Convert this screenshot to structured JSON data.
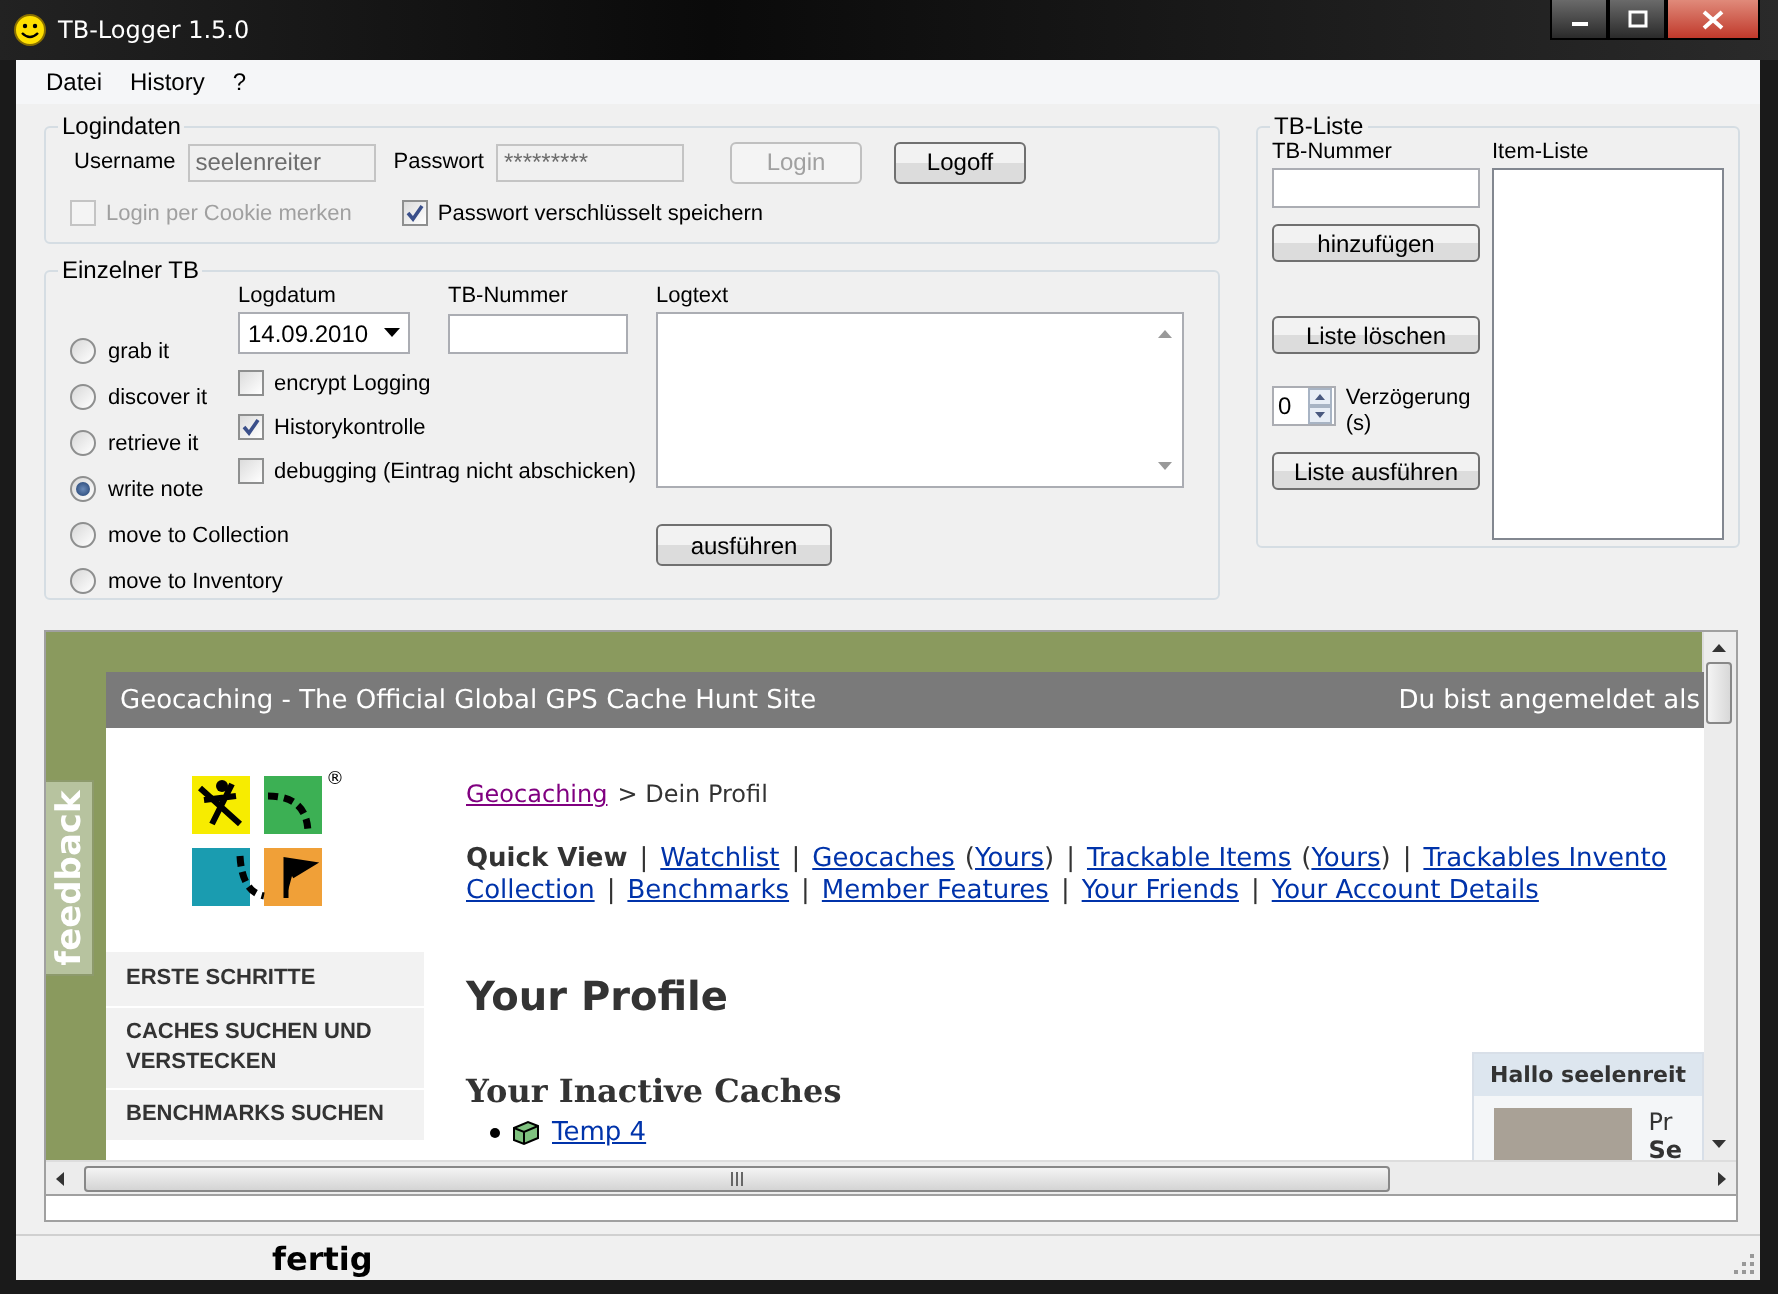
{
  "window": {
    "title": "TB-Logger 1.5.0"
  },
  "menu": [
    {
      "label": "Datei"
    },
    {
      "label": "History"
    },
    {
      "label": "?"
    }
  ],
  "login": {
    "title": "Logindaten",
    "username_label": "Username",
    "username": "seelenreiter",
    "password_label": "Passwort",
    "password": "*********",
    "buttons": [
      {
        "label": "Login",
        "disabled": true
      },
      {
        "label": "Logoff",
        "disabled": false
      }
    ],
    "options": [
      {
        "label": "Login per Cookie merken",
        "checked": false,
        "disabled": true
      },
      {
        "label": "Passwort verschlüsselt speichern",
        "checked": true,
        "disabled": false
      }
    ]
  },
  "single": {
    "title": "Einzelner TB",
    "actions": [
      {
        "label": "grab it",
        "selected": false
      },
      {
        "label": "discover it",
        "selected": false
      },
      {
        "label": "retrieve it",
        "selected": false
      },
      {
        "label": "write note",
        "selected": true
      },
      {
        "label": "move to Collection",
        "selected": false
      },
      {
        "label": "move to Inventory",
        "selected": false
      }
    ],
    "date_label": "Logdatum",
    "date": "14.09.2010",
    "number_label": "TB-Nummer",
    "options": [
      {
        "label": "encrypt Logging",
        "checked": false
      },
      {
        "label": "Historykontrolle",
        "checked": true
      },
      {
        "label": "debugging (Eintrag nicht abschicken)",
        "checked": false
      }
    ],
    "logtext_label": "Logtext",
    "run_button": "ausführen"
  },
  "list": {
    "title": "TB-Liste",
    "number_label": "TB-Nummer",
    "add_button": "hinzufügen",
    "clear_button": "Liste löschen",
    "delay": "0",
    "delay_label": "Verzögerung (s)",
    "run_button": "Liste ausführen",
    "items_label": "Item-Liste"
  },
  "browser": {
    "header_title": "Geocaching - The Official Global GPS Cache Hunt Site",
    "header_user": "Du bist angemeldet als",
    "feedback": "feedback",
    "logo_mark": "®",
    "nav": [
      "ERSTE SCHRITTE",
      "CACHES SUCHEN UND VERSTECKEN",
      "BENCHMARKS SUCHEN"
    ],
    "breadcrumb": {
      "link": "Geocaching",
      "rest": "> Dein Profil"
    },
    "quick_view": [
      [
        {
          "kind": "label",
          "text": "Quick View"
        },
        {
          "kind": "sep",
          "text": "|"
        },
        {
          "kind": "link",
          "text": "Watchlist"
        },
        {
          "kind": "sep",
          "text": "|"
        },
        {
          "kind": "link",
          "text": "Geocaches"
        },
        {
          "kind": "plain",
          "text": "("
        },
        {
          "kind": "link",
          "text": "Yours"
        },
        {
          "kind": "plain",
          "text": ")"
        },
        {
          "kind": "sep",
          "text": "|"
        },
        {
          "kind": "link",
          "text": "Trackable Items"
        },
        {
          "kind": "plain",
          "text": "("
        },
        {
          "kind": "link",
          "text": "Yours"
        },
        {
          "kind": "plain",
          "text": ")"
        },
        {
          "kind": "sep",
          "text": "|"
        },
        {
          "kind": "link",
          "text": "Trackables Invento"
        }
      ],
      [
        {
          "kind": "link",
          "text": "Collection"
        },
        {
          "kind": "sep",
          "text": "|"
        },
        {
          "kind": "link",
          "text": "Benchmarks"
        },
        {
          "kind": "sep",
          "text": "|"
        },
        {
          "kind": "link",
          "text": "Member Features"
        },
        {
          "kind": "sep",
          "text": "|"
        },
        {
          "kind": "link",
          "text": "Your Friends"
        },
        {
          "kind": "sep",
          "text": "|"
        },
        {
          "kind": "link",
          "text": "Your Account Details"
        }
      ]
    ],
    "heading": "Your Profile",
    "subheading": "Your Inactive Caches",
    "caches": [
      "Temp 4"
    ],
    "hello": {
      "title": "Hallo seelenreit",
      "lines": [
        "Pr",
        "Se"
      ]
    }
  },
  "status_bar": {
    "text": "fertig"
  }
}
